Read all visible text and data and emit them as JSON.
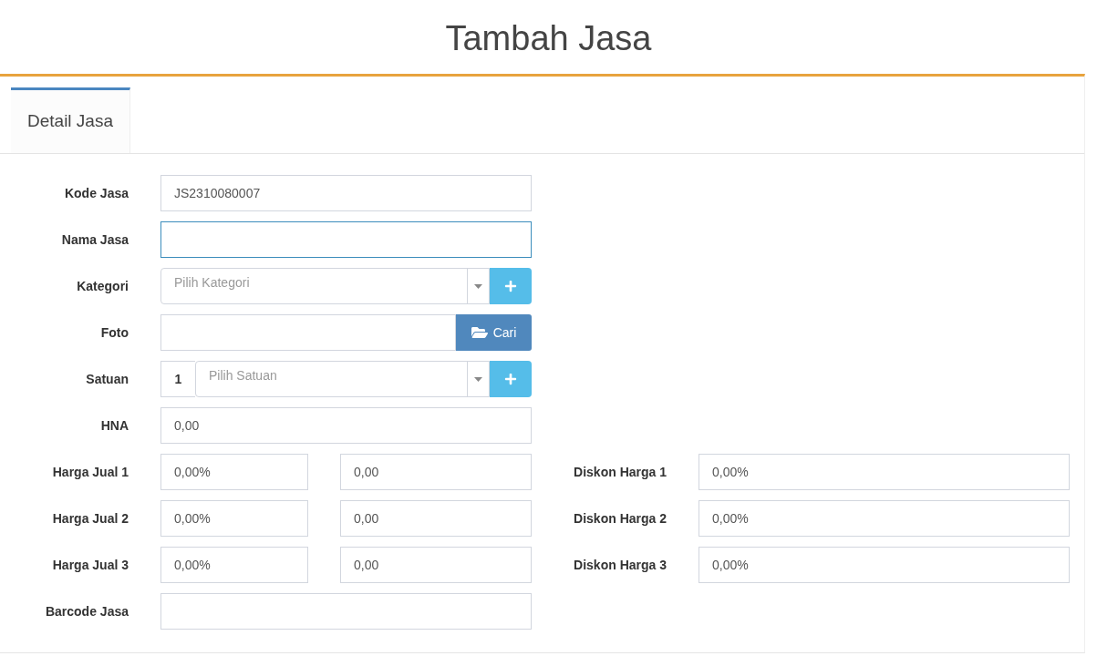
{
  "page_title": "Tambah Jasa",
  "tabs": [
    {
      "label": "Detail Jasa",
      "selected": true
    }
  ],
  "fields": [
    {
      "kind": "text",
      "label": "Kode Jasa",
      "value": "JS2310080007",
      "focused": false
    },
    {
      "kind": "text",
      "label": "Nama Jasa",
      "focused": true
    },
    {
      "kind": "select_add",
      "label": "Kategori",
      "placeholder": "Pilih Kategori"
    },
    {
      "kind": "file",
      "label": "Foto",
      "button": "Cari"
    },
    {
      "kind": "unit_select",
      "label": "Satuan",
      "prefix": "1",
      "placeholder": "Pilih Satuan"
    },
    {
      "kind": "text",
      "label": "HNA",
      "value": "0,00",
      "focused": false
    }
  ],
  "price_rows": [
    {
      "label": "Harga Jual 1",
      "percent": "0,00%",
      "amount": "0,00",
      "discount_label": "Diskon Harga 1",
      "discount": "0,00%"
    },
    {
      "label": "Harga Jual 2",
      "percent": "0,00%",
      "amount": "0,00",
      "discount_label": "Diskon Harga 2",
      "discount": "0,00%"
    },
    {
      "label": "Harga Jual 3",
      "percent": "0,00%",
      "amount": "0,00",
      "discount_label": "Diskon Harga 3",
      "discount": "0,00%"
    }
  ],
  "barcode_field": {
    "label": "Barcode Jasa"
  }
}
